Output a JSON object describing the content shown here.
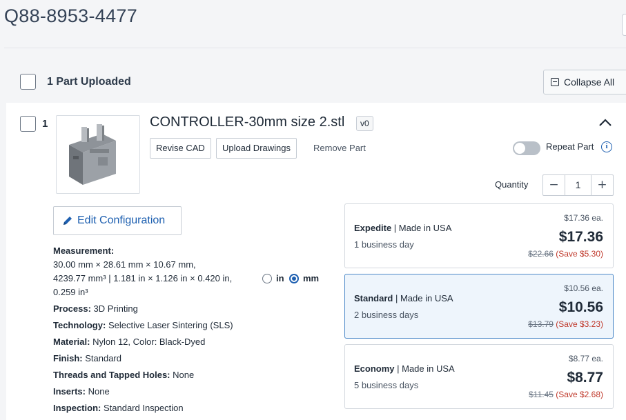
{
  "quote": {
    "id": "Q88-8953-4477"
  },
  "parts_header": {
    "label": "1 Part Uploaded",
    "collapse_label": "Collapse All"
  },
  "part": {
    "index": "1",
    "name": "CONTROLLER-30mm size 2.stl",
    "version": "v0",
    "revise_label": "Revise CAD",
    "upload_label": "Upload Drawings",
    "remove_label": "Remove Part",
    "repeat_label": "Repeat Part",
    "repeat_enabled": false,
    "quantity_label": "Quantity",
    "quantity": "1",
    "edit_config_label": "Edit Configuration"
  },
  "specs": {
    "measurement_label": "Measurement:",
    "measurement_line1": "30.00 mm × 28.61 mm × 10.67 mm,",
    "measurement_line2": "4239.77 mm³ | 1.181 in × 1.126 in × 0.420 in,",
    "measurement_line3": "0.259 in³",
    "unit_in": "in",
    "unit_mm": "mm",
    "selected_unit": "mm",
    "process_label": "Process:",
    "process": "3D Printing",
    "technology_label": "Technology:",
    "technology": "Selective Laser Sintering (SLS)",
    "material_label": "Material:",
    "material": "Nylon 12, Color: Black-Dyed",
    "finish_label": "Finish:",
    "finish": "Standard",
    "threads_label": "Threads and Tapped Holes:",
    "threads": "None",
    "inserts_label": "Inserts:",
    "inserts": "None",
    "inspection_label": "Inspection:",
    "inspection": "Standard Inspection"
  },
  "pricing": [
    {
      "tier": "Expedite",
      "origin": "Made in USA",
      "days": "1 business day",
      "each": "$17.36 ea.",
      "price": "$17.36",
      "old": "$22.66",
      "save": "(Save $5.30)",
      "selected": false
    },
    {
      "tier": "Standard",
      "origin": "Made in USA",
      "days": "2 business days",
      "each": "$10.56 ea.",
      "price": "$10.56",
      "old": "$13.79",
      "save": "(Save $3.23)",
      "selected": true
    },
    {
      "tier": "Economy",
      "origin": "Made in USA",
      "days": "5 business days",
      "each": "$8.77 ea.",
      "price": "$8.77",
      "old": "$11.45",
      "save": "(Save $2.68)",
      "selected": false
    }
  ],
  "colors": {
    "accent": "#1d5fb0",
    "savings": "#c0392b",
    "selected_bg": "#eef5fc"
  },
  "icons": {
    "collapse": "collapse-square-icon",
    "chevron": "chevron-up-icon",
    "info": "info-icon",
    "edit": "pencil-icon"
  }
}
